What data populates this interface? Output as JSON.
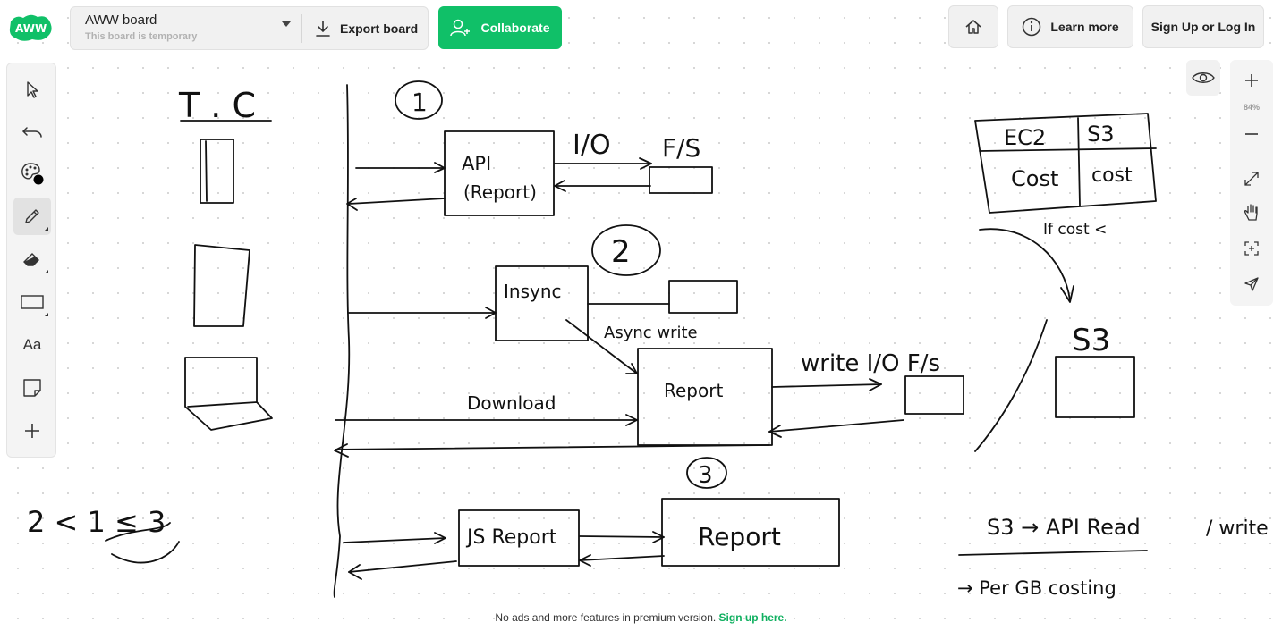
{
  "app": {
    "logo_text": "AWW",
    "brand_color": "#10c068"
  },
  "board": {
    "title": "AWW board",
    "subtitle": "This board is temporary",
    "export_label": "Export board"
  },
  "header": {
    "collaborate_label": "Collaborate",
    "learn_more_label": "Learn more",
    "signup_label": "Sign Up or Log In"
  },
  "left_toolbar": {
    "tools": [
      {
        "name": "select-tool",
        "icon": "cursor-icon"
      },
      {
        "name": "undo-tool",
        "icon": "undo-icon"
      },
      {
        "name": "color-tool",
        "icon": "palette-icon",
        "color": "#000000"
      },
      {
        "name": "pencil-tool",
        "icon": "pencil-icon",
        "active": true
      },
      {
        "name": "eraser-tool",
        "icon": "eraser-icon"
      },
      {
        "name": "shape-tool",
        "icon": "rectangle-icon"
      },
      {
        "name": "text-tool",
        "icon": "text-icon",
        "label": "Aa"
      },
      {
        "name": "sticky-note-tool",
        "icon": "sticky-note-icon"
      },
      {
        "name": "add-tool",
        "icon": "plus-icon"
      }
    ]
  },
  "right_toolbar": {
    "zoom_level": "84%",
    "tools": [
      "zoom-in-icon",
      "zoom-out-icon",
      "fit-screen-icon",
      "hand-icon",
      "focus-icon",
      "send-icon"
    ],
    "view_icon": "eye-icon"
  },
  "canvas": {
    "labels": {
      "tc": "T . C",
      "circle_1": "1",
      "circle_2": "2",
      "circle_3": "3",
      "api_line1": "API",
      "api_line2": "(Report)",
      "io": "I/O",
      "fs": "F/S",
      "insync": "Insync",
      "async_write": "Async write",
      "write_io_fs": "write I/O F/s",
      "report_mid": "Report",
      "download": "Download",
      "js_report": "JS Report",
      "report_bottom": "Report",
      "ec2": "EC2",
      "s3_head": "S3",
      "cost1": "Cost",
      "cost2": "cost",
      "if_cost": "If cost <",
      "s3_label": "S3",
      "inequality": "2 < 1 ≤ 3",
      "s3_api": "S3 → API Read",
      "slash_write": "/ write",
      "per_gb": "→ Per GB costing"
    }
  },
  "footer": {
    "text": "No ads and more features in premium version.",
    "link": "Sign up here."
  }
}
